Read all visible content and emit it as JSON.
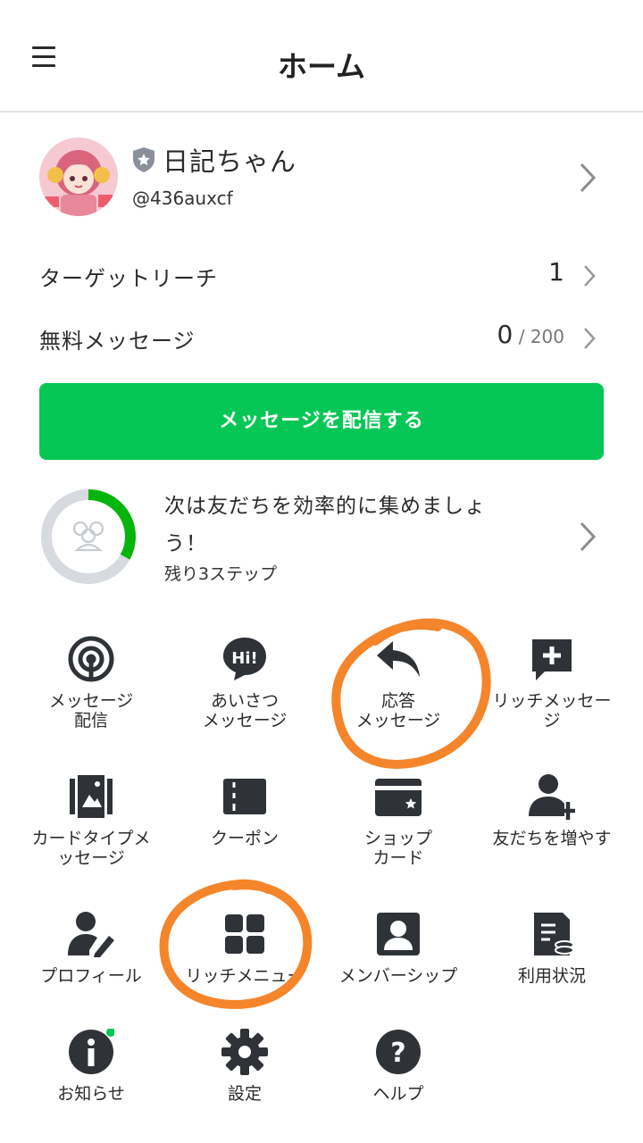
{
  "header": {
    "title": "ホーム"
  },
  "account": {
    "name": "日記ちゃん",
    "id": "@436auxcf"
  },
  "stats": [
    {
      "label": "ターゲットリーチ",
      "value": "1",
      "suffix": ""
    },
    {
      "label": "無料メッセージ",
      "value": "0",
      "suffix": " / 200"
    }
  ],
  "cta": {
    "label": "メッセージを配信する"
  },
  "progress": {
    "line1": "次は友だちを効率的に集めましょ",
    "line2": "う！",
    "sub": "残り3ステップ",
    "fraction": 0.33
  },
  "menu": [
    {
      "line1": "メッセージ",
      "line2": "配信",
      "icon": "broadcast-icon"
    },
    {
      "line1": "あいさつ",
      "line2": "メッセージ",
      "icon": "hi-bubble-icon"
    },
    {
      "line1": "応答",
      "line2": "メッセージ",
      "icon": "reply-arrow-icon"
    },
    {
      "line1": "リッチメッセー",
      "line2": "ジ",
      "icon": "add-message-icon"
    },
    {
      "line1": "カードタイプメ",
      "line2": "ッセージ",
      "icon": "card-stack-icon"
    },
    {
      "line1": "クーポン",
      "line2": "",
      "icon": "coupon-icon"
    },
    {
      "line1": "ショップ",
      "line2": "カード",
      "icon": "shop-card-icon"
    },
    {
      "line1": "友だちを増やす",
      "line2": "",
      "icon": "add-friend-icon"
    },
    {
      "line1": "プロフィール",
      "line2": "",
      "icon": "profile-edit-icon"
    },
    {
      "line1": "リッチメニュー",
      "line2": "",
      "icon": "grid-menu-icon"
    },
    {
      "line1": "メンバーシップ",
      "line2": "",
      "icon": "membership-icon"
    },
    {
      "line1": "利用状況",
      "line2": "",
      "icon": "usage-icon"
    },
    {
      "line1": "お知らせ",
      "line2": "",
      "icon": "info-icon"
    },
    {
      "line1": "設定",
      "line2": "",
      "icon": "gear-icon"
    },
    {
      "line1": "ヘルプ",
      "line2": "",
      "icon": "help-icon"
    }
  ],
  "colors": {
    "accent": "#06c755",
    "icon": "#2f3338",
    "annotation": "#f5852a"
  }
}
